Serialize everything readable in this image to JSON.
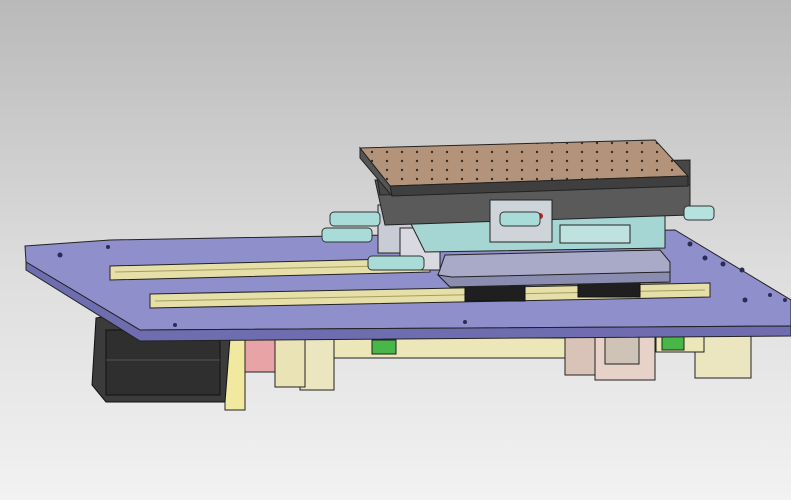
{
  "viewport": {
    "content": "cad-linear-stage-assembly",
    "colors": {
      "background_top": "#b9b9b9",
      "background_bottom": "#f2f2f2",
      "base_plate": "#8f8fcc",
      "rails": "#e6e0a8",
      "top_table": "#b3937a",
      "carriage": "#a6d6d4",
      "motor": "#3b3b3b",
      "bearing_blocks": "#ebe6c0",
      "coupling": "#e8a3a6",
      "brackets": "#47b847"
    }
  }
}
